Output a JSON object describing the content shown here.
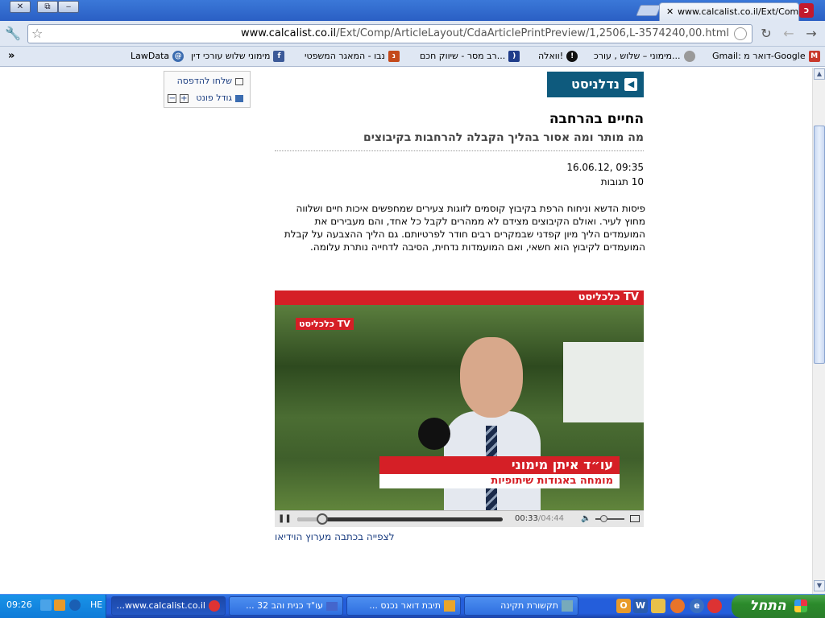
{
  "browser": {
    "tab_title": "www.calcalist.co.il/Ext/Comp/",
    "url_host": "www.calcalist.co.il",
    "url_path": "/Ext/Comp/ArticleLayout/CdaArticlePrintPreview/1,2506,L-3574240,00.html",
    "bookmarks": [
      {
        "label": "Gmail: דואר מ-Google",
        "icon": "gmail-icon",
        "color": "#c8382c"
      },
      {
        "label": "מימוני – שלוש , עורכ...",
        "icon": "globe-icon",
        "color": "#888888"
      },
      {
        "label": "וואלה!",
        "icon": "walla-icon",
        "color": "#111111"
      },
      {
        "label": "רב מסר - שיווק חכם...",
        "icon": "ravmeser-icon",
        "color": "#1f3c8a"
      },
      {
        "label": "נבו - המאגר המשפטי",
        "icon": "nevo-icon",
        "color": "#c44a1c"
      },
      {
        "label": "מימוני שלוש עורכי דין",
        "icon": "facebook-icon",
        "color": "#3b5998"
      },
      {
        "label": "LawData",
        "icon": "lawdata-icon",
        "color": "#3b6cb0"
      }
    ],
    "overflow": "»"
  },
  "page": {
    "print_link": "שלחו להדפסה",
    "font_size_label": "גודל פונט",
    "logo_text": "נדלניסט",
    "headline": "החיים בהרחבה",
    "subhead": "מה מותר ומה אסור בהליך הקבלה להרחבות בקיבוצים",
    "date": "09:35 ,16.06.12",
    "responses": "10 תגובות",
    "body_lines": [
      "פיסות הדשא וניחוח הרפת בקיבוץ קוסמים לזוגות צעירים שמחפשים איכות חיים ושלווה",
      "מחוץ לעיר. ואולם הקיבוצים מצידם לא ממהרים לקבל כל אחד, והם מעבירים את",
      "המועמדים הליך מיון קפדני שבמקרים רבים חודר לפרטיותם. גם הליך ההצבעה על קבלת",
      "המועמדים לקיבוץ הוא חשאי, ואם המועמדות נדחית, הסיבה לדחייה נותרת עלומה."
    ],
    "video": {
      "header": "כלכליסט TV",
      "corner_tag": "כלכליסט TV",
      "speaker_name": "עו״ד איתן מימוני",
      "speaker_title": "מומחה באגודות שיתופיות",
      "time_current": "00:33",
      "time_total": "04:44",
      "progress": 0.12
    },
    "watch_link": "לצפייה בכתבה מערוץ הוידיאו"
  },
  "taskbar": {
    "start_label": "התחל",
    "tasks": [
      {
        "label": "תקשורת תקינה",
        "icon": "network-icon"
      },
      {
        "label": "תיבת דואר נכנס ...",
        "icon": "outlook-icon"
      },
      {
        "label": "עו\"ד כנית והב 32 ...",
        "icon": "window-icon"
      },
      {
        "label": "www.calcalist.co.il...",
        "icon": "chrome-icon",
        "active": true
      }
    ],
    "language": "HE",
    "clock": "09:26"
  }
}
